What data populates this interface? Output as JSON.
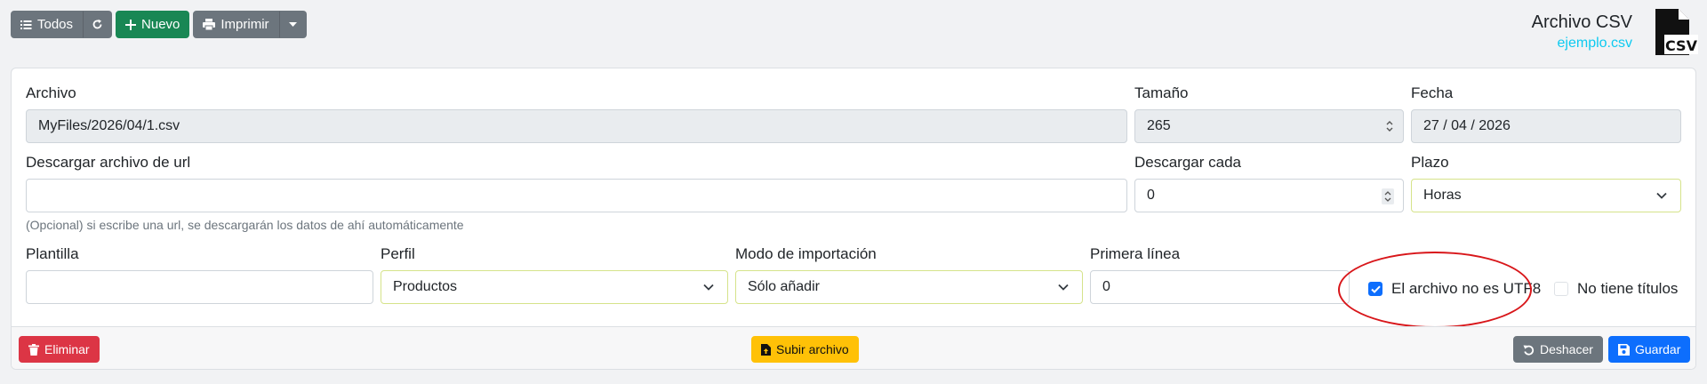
{
  "toolbar": {
    "all_label": "Todos",
    "new_label": "Nuevo",
    "print_label": "Imprimir"
  },
  "header": {
    "title": "Archivo CSV",
    "subtitle": "ejemplo.csv",
    "icon_text": "CSV"
  },
  "form": {
    "file": {
      "label": "Archivo",
      "value": "MyFiles/2026/04/1.csv"
    },
    "size": {
      "label": "Tamaño",
      "value": "265"
    },
    "date": {
      "label": "Fecha",
      "value": "27 / 04 / 2026"
    },
    "url": {
      "label": "Descargar archivo de url",
      "value": "",
      "help": "(Opcional) si escribe una url, se descargarán los datos de ahí automáticamente"
    },
    "download_every": {
      "label": "Descargar cada",
      "value": "0"
    },
    "term": {
      "label": "Plazo",
      "value": "Horas"
    },
    "template": {
      "label": "Plantilla",
      "value": ""
    },
    "profile": {
      "label": "Perfil",
      "value": "Productos"
    },
    "import_mode": {
      "label": "Modo de importación",
      "value": "Sólo añadir"
    },
    "first_line": {
      "label": "Primera línea",
      "value": "0"
    },
    "not_utf8": {
      "label": "El archivo no es UTF8",
      "checked": true
    },
    "no_titles": {
      "label": "No tiene títulos",
      "checked": false
    }
  },
  "footer": {
    "delete_label": "Eliminar",
    "upload_label": "Subir archivo",
    "undo_label": "Deshacer",
    "save_label": "Guardar"
  },
  "colors": {
    "secondary": "#6c757d",
    "success": "#198754",
    "danger": "#dc3545",
    "warning": "#ffc107",
    "primary": "#0d6efd",
    "info": "#0dcaf0",
    "highlight_oval": "#d8161a"
  }
}
